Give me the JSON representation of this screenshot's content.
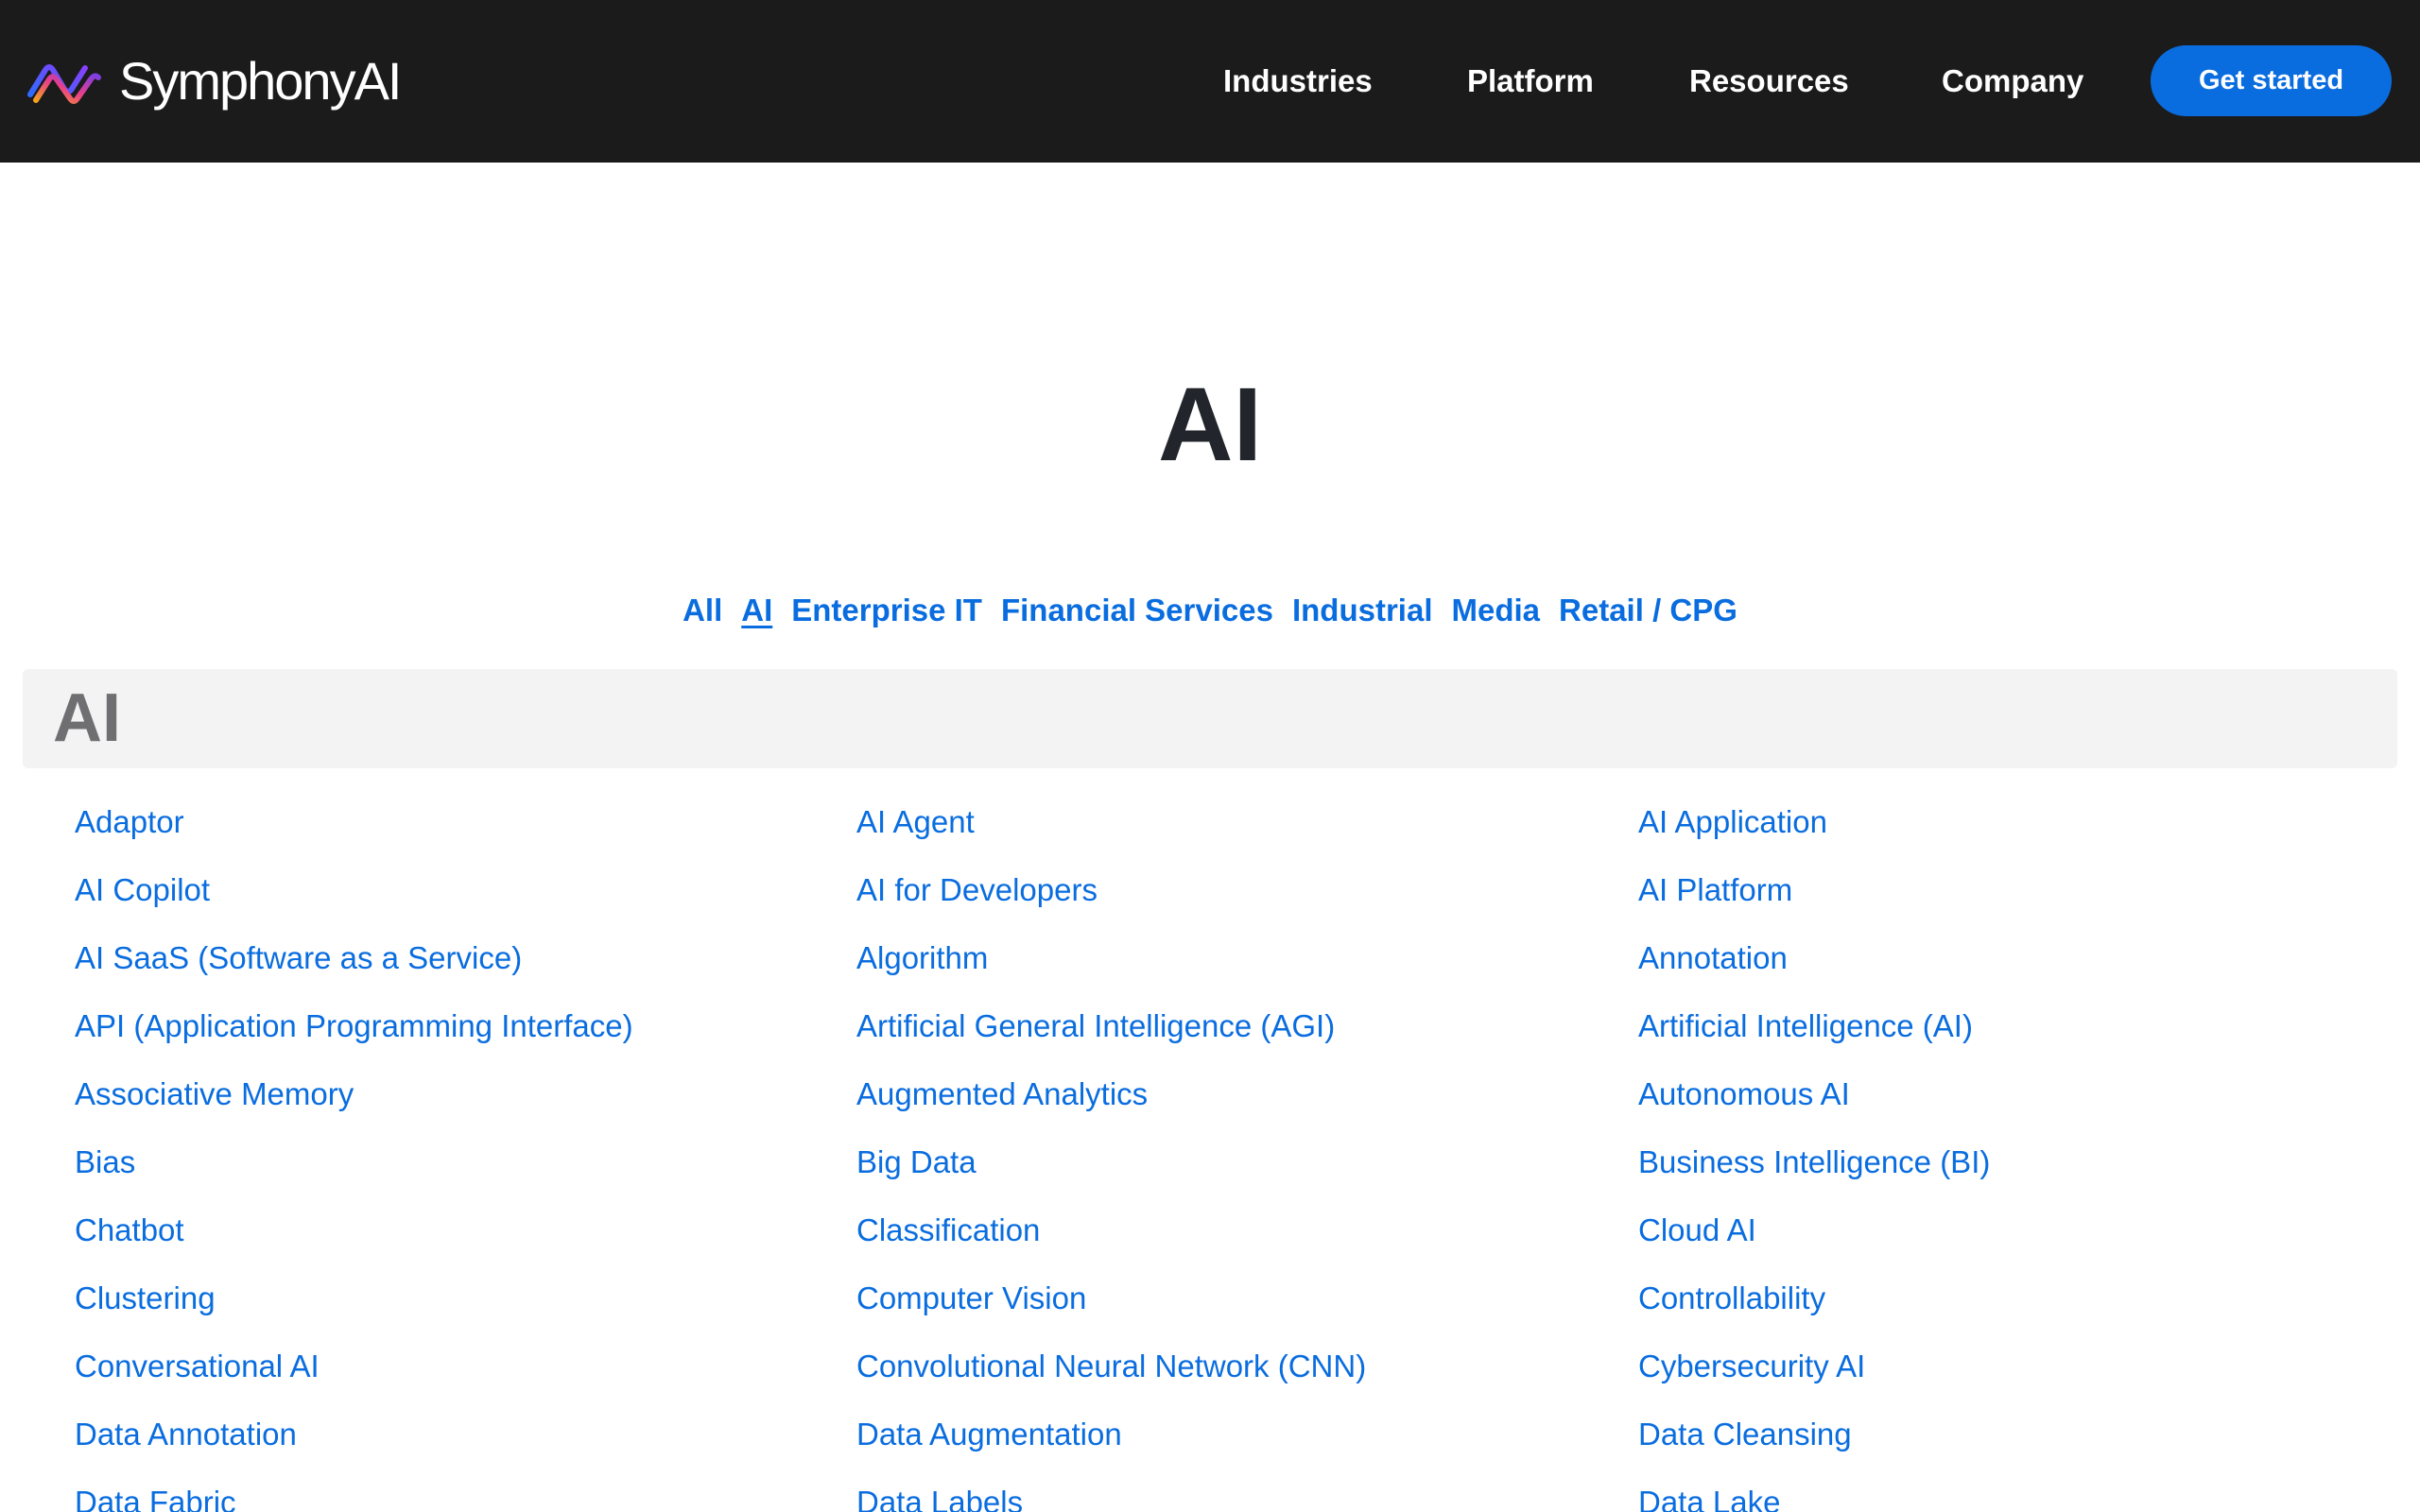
{
  "header": {
    "logo_text": "SymphonyAI",
    "logo_icon": "symphonyai-logo-mark",
    "nav": [
      "Industries",
      "Platform",
      "Resources",
      "Company"
    ],
    "cta_label": "Get started"
  },
  "page": {
    "title": "AI"
  },
  "filters": {
    "items": [
      "All",
      "AI",
      "Enterprise IT",
      "Financial Services",
      "Industrial",
      "Media",
      "Retail / CPG"
    ],
    "active": "AI"
  },
  "section": {
    "letter": "AI",
    "terms": [
      "Adaptor",
      "AI Agent",
      "AI Application",
      "AI Copilot",
      "AI for Developers",
      "AI Platform",
      "AI SaaS (Software as a Service)",
      "Algorithm",
      "Annotation",
      "API (Application Programming Interface)",
      "Artificial General Intelligence (AGI)",
      "Artificial Intelligence (AI)",
      "Associative Memory",
      "Augmented Analytics",
      "Autonomous AI",
      "Bias",
      "Big Data",
      "Business Intelligence (BI)",
      "Chatbot",
      "Classification",
      "Cloud AI",
      "Clustering",
      "Computer Vision",
      "Controllability",
      "Conversational AI",
      "Convolutional Neural Network (CNN)",
      "Cybersecurity AI",
      "Data Annotation",
      "Data Augmentation",
      "Data Cleansing",
      "Data Fabric",
      "Data Labels",
      "Data Lake"
    ]
  },
  "colors": {
    "header_bg": "#1b1b1c",
    "accent": "#0a6ddf",
    "heading": "#22252b",
    "section_band": "#f3f3f3",
    "section_letter": "#6f6f72"
  }
}
